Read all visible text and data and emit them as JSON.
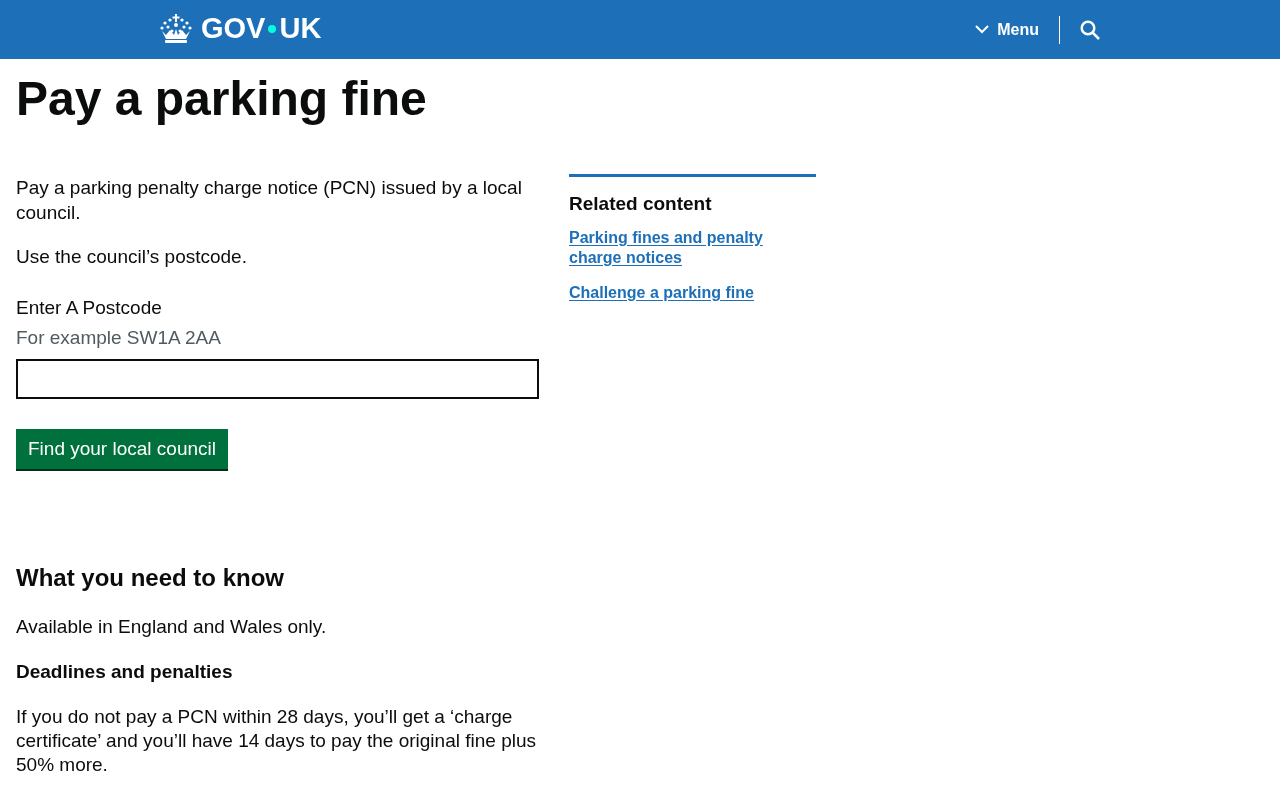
{
  "header": {
    "logo": {
      "left": "GOV",
      "right": "UK"
    },
    "menu_button": {
      "label": "Menu",
      "expanded": false
    }
  },
  "title": "Pay a parking fine",
  "intro": [
    "Pay a parking penalty charge notice (PCN) issued by a local council.",
    "Use the council’s postcode."
  ],
  "form": {
    "label": "Enter A Postcode",
    "hint": "For example SW1A 2AA",
    "button": "Find your local council"
  },
  "related": {
    "heading": "Related content",
    "links": [
      "Parking fines and penalty charge notices",
      "Challenge a parking fine"
    ]
  },
  "what_you_need_to_know": {
    "heading": "What you need to know",
    "paragraphs": [
      "Available in England and Wales only."
    ]
  },
  "deadlines": {
    "heading": "Deadlines and penalties",
    "paragraphs": [
      "If you do not pay a PCN within 28 days, you’ll get a ‘charge certificate’ and you’ll have 14 days to pay the original fine plus 50% more."
    ]
  }
}
